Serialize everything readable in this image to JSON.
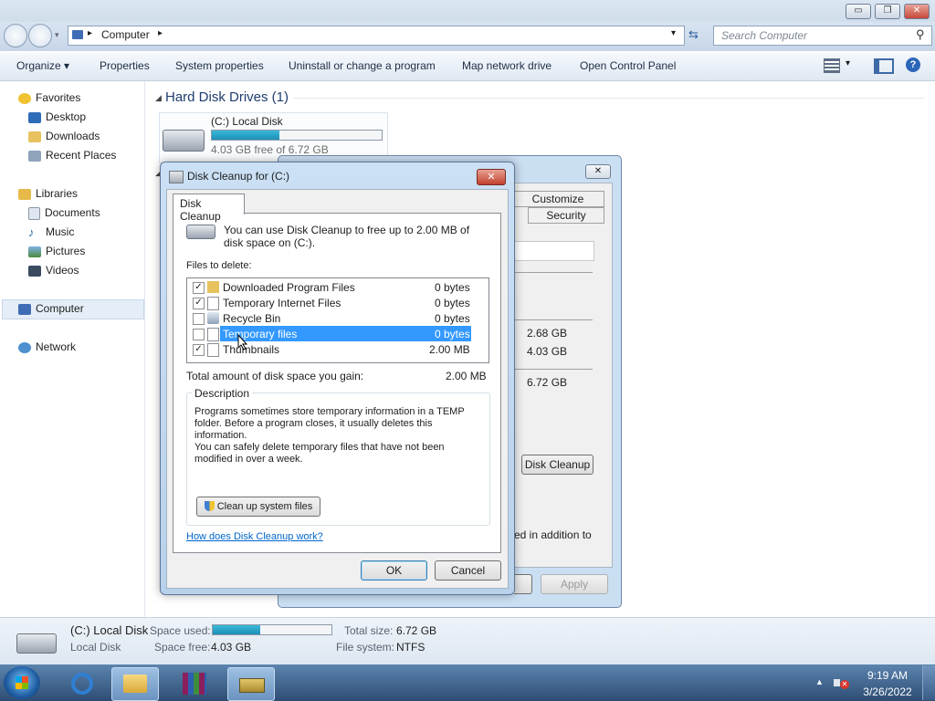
{
  "explorer": {
    "window_controls": {
      "minimize": "▭",
      "maximize": "❐",
      "close": "✕"
    },
    "address": "Computer",
    "search_placeholder": "Search Computer",
    "toolbar": {
      "organize": "Organize ▾",
      "properties": "Properties",
      "system_properties": "System properties",
      "uninstall": "Uninstall or change a program",
      "map_drive": "Map network drive",
      "control_panel": "Open Control Panel"
    },
    "nav": {
      "favorites": "Favorites",
      "desktop": "Desktop",
      "downloads": "Downloads",
      "recent": "Recent Places",
      "libraries": "Libraries",
      "documents": "Documents",
      "music": "Music",
      "pictures": "Pictures",
      "videos": "Videos",
      "computer": "Computer",
      "network": "Network"
    },
    "section_title": "Hard Disk Drives (1)",
    "disk": {
      "name": "(C:) Local Disk",
      "free_text": "4.03 GB free of 6.72 GB",
      "used_fraction": 0.4
    }
  },
  "details_pane": {
    "name": "(C:) Local Disk",
    "type": "Local Disk",
    "space_used_label": "Space used:",
    "space_free_label": "Space free:",
    "space_free": "4.03 GB",
    "total_size_label": "Total size:",
    "total_size": "6.72 GB",
    "file_system_label": "File system:",
    "file_system": "NTFS"
  },
  "properties_dialog": {
    "tabs": {
      "customize": "Customize",
      "security": "Security"
    },
    "used": "2.68 GB",
    "free": "4.03 GB",
    "capacity": "6.72 GB",
    "disk_cleanup_button": "Disk Cleanup",
    "partial_text": "ed in addition to",
    "apply": "Apply"
  },
  "cleanup_dialog": {
    "title": "Disk Cleanup for  (C:)",
    "tab": "Disk Cleanup",
    "intro": "You can use Disk Cleanup to free up to 2.00 MB of disk space on  (C:).",
    "files_label": "Files to delete:",
    "files": [
      {
        "name": "Downloaded Program Files",
        "size": "0 bytes",
        "checked": true
      },
      {
        "name": "Temporary Internet Files",
        "size": "0 bytes",
        "checked": true
      },
      {
        "name": "Recycle Bin",
        "size": "0 bytes",
        "checked": false
      },
      {
        "name": "Temporary files",
        "size": "0 bytes",
        "checked": false
      },
      {
        "name": "Thumbnails",
        "size": "2.00 MB",
        "checked": true
      }
    ],
    "total_label": "Total amount of disk space you gain:",
    "total_value": "2.00 MB",
    "description_label": "Description",
    "description_1": "Programs sometimes store temporary information in a TEMP folder. Before a program closes, it usually deletes this information.",
    "description_2": "You can safely delete temporary files that have not been modified in over a week.",
    "cleanup_system": "Clean up system files",
    "how_link": "How does Disk Cleanup work?",
    "ok": "OK",
    "cancel": "Cancel",
    "close": "✕"
  },
  "taskbar": {
    "time": "9:19 AM",
    "date": "3/26/2022"
  }
}
